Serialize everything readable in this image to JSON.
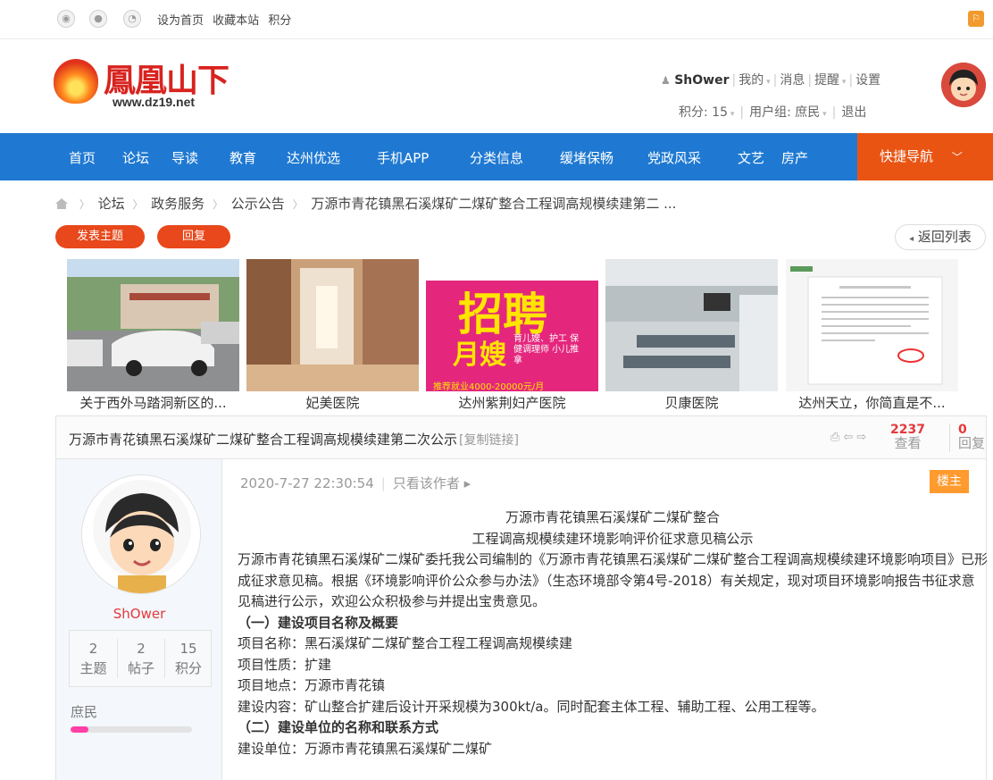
{
  "topbar": {
    "links": [
      "设为首页",
      "收藏本站",
      "积分"
    ]
  },
  "header": {
    "logo_text": "鳳凰山下",
    "logo_url": "www.dz19.net",
    "user": {
      "name": "ShOwer",
      "my": "我的",
      "messages": "消息",
      "remind": "提醒",
      "settings": "设置",
      "points": "积分: 15",
      "group": "用户组: 庶民",
      "logout": "退出"
    }
  },
  "nav": {
    "items": [
      "首页",
      "论坛",
      "导读",
      "教育",
      "达州优选",
      "手机APP",
      "分类信息",
      "缓堵保畅",
      "党政风采",
      "文艺",
      "房产"
    ],
    "quick": "快捷导航"
  },
  "breadcrumb": [
    "论坛",
    "政务服务",
    "公示公告",
    "万源市青花镇黑石溪煤矿二煤矿整合工程调高规模续建第二 ..."
  ],
  "actions": {
    "new_topic": "发表主题",
    "reply": "回复",
    "back": "返回列表"
  },
  "gallery": [
    {
      "caption": "关于西外马踏洞新区的..."
    },
    {
      "caption": "妃美医院"
    },
    {
      "caption": "达州紫荆妇产医院",
      "poster_big": "招聘",
      "poster_sub": "月嫂",
      "poster_small": "育儿嫂、护工 保健调理师 小儿推拿",
      "poster_salary": "推荐就业4000-20000元/月"
    },
    {
      "caption": "贝康医院"
    },
    {
      "caption": "达州天立，你简直是不..."
    }
  ],
  "thread": {
    "title": "万源市青花镇黑石溪煤矿二煤矿整合工程调高规模续建第二次公示",
    "copy_link": "[复制链接]",
    "views": "2237",
    "views_label": "查看",
    "replies": "0",
    "replies_label": "回复"
  },
  "author": {
    "name": "ShOwer",
    "stats": [
      {
        "value": "2",
        "label": "主题"
      },
      {
        "value": "2",
        "label": "帖子"
      },
      {
        "value": "15",
        "label": "积分"
      }
    ],
    "group": "庶民",
    "progress": 0.15
  },
  "post": {
    "time": "2020-7-27 22:30:54",
    "only_author": "只看该作者 ▸",
    "floor": "楼主",
    "heading1": "万源市青花镇黑石溪煤矿二煤矿整合",
    "heading2": "工程调高规模续建环境影响评价征求意见稿公示",
    "para": "万源市青花镇黑石溪煤矿二煤矿委托我公司编制的《万源市青花镇黑石溪煤矿二煤矿整合工程调高规模续建环境影响项目》已形成征求意见稿。根据《环境影响评价公众参与办法》（生态环境部令第4号-2018）有关规定，现对项目环境影响报告书征求意见稿进行公示，欢迎公众积极参与并提出宝贵意见。",
    "sec1": "（一）建设项目名称及概要",
    "line1": "项目名称：黑石溪煤矿二煤矿整合工程工程调高规模续建",
    "line2": "项目性质：扩建",
    "line3": "项目地点：万源市青花镇",
    "line4": "建设内容：矿山整合扩建后设计开采规模为300kt/a。同时配套主体工程、辅助工程、公用工程等。",
    "sec2": "（二）建设单位的名称和联系方式",
    "line5": "建设单位：万源市青花镇黑石溪煤矿二煤矿"
  }
}
